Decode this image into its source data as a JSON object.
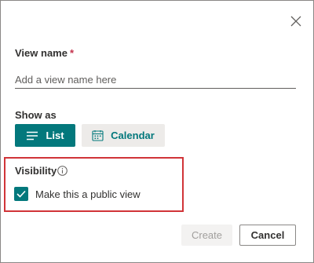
{
  "dialog": {
    "view_name_label": "View name",
    "required_marker": "*",
    "view_name_placeholder": "Add a view name here",
    "view_name_value": "",
    "show_as_label": "Show as",
    "list_button": "List",
    "calendar_button": "Calendar",
    "visibility_label": "Visibility",
    "public_view_label": "Make this a public view",
    "public_view_checked": true,
    "create_button": "Create",
    "cancel_button": "Cancel"
  },
  "icons": {
    "close": "close-icon",
    "list": "list-icon",
    "calendar": "calendar-icon",
    "info": "info-icon",
    "check": "checkmark-icon"
  },
  "colors": {
    "accent": "#03787c",
    "highlight_border": "#d13438",
    "required": "#c4314b",
    "disabled_text": "#a19f9d"
  }
}
